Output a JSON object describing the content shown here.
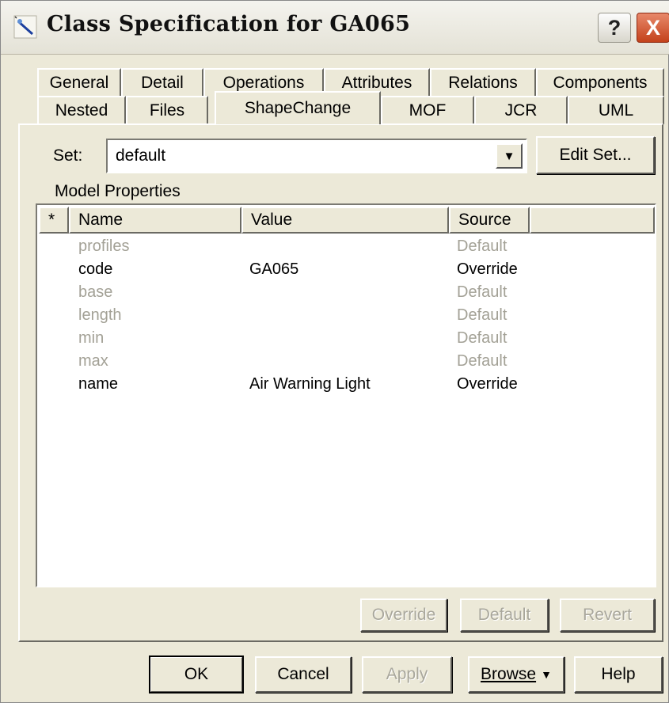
{
  "window": {
    "title": "Class Specification for GA065",
    "help_label": "?",
    "close_label": "X"
  },
  "tabs": {
    "row1": [
      "General",
      "Detail",
      "Operations",
      "Attributes",
      "Relations",
      "Components"
    ],
    "row2": [
      "Nested",
      "Files",
      "ShapeChange",
      "MOF",
      "JCR",
      "UML"
    ],
    "selected": "ShapeChange"
  },
  "set": {
    "label": "Set:",
    "value": "default",
    "edit_button": "Edit Set..."
  },
  "model_properties": {
    "label": "Model Properties",
    "columns": [
      "*",
      "Name",
      "Value",
      "Source"
    ],
    "rows": [
      {
        "name": "profiles",
        "value": "",
        "source": "Default",
        "muted": true
      },
      {
        "name": "code",
        "value": "GA065",
        "source": "Override",
        "muted": false
      },
      {
        "name": "base",
        "value": "",
        "source": "Default",
        "muted": true
      },
      {
        "name": "length",
        "value": "",
        "source": "Default",
        "muted": true
      },
      {
        "name": "min",
        "value": "",
        "source": "Default",
        "muted": true
      },
      {
        "name": "max",
        "value": "",
        "source": "Default",
        "muted": true
      },
      {
        "name": "name",
        "value": "Air Warning Light",
        "source": "Override",
        "muted": false
      }
    ]
  },
  "property_buttons": {
    "override": "Override",
    "default": "Default",
    "revert": "Revert"
  },
  "footer": {
    "ok": "OK",
    "cancel": "Cancel",
    "apply": "Apply",
    "browse": "Browse",
    "browse_arrow": "▼",
    "help": "Help"
  },
  "colors": {
    "dialog_bg": "#ece9d8",
    "muted_text": "#a3a196",
    "close_button": "#c4421b"
  },
  "icons": {
    "app": "magnifier-wand-icon",
    "dropdown": "chevron-down-icon"
  }
}
